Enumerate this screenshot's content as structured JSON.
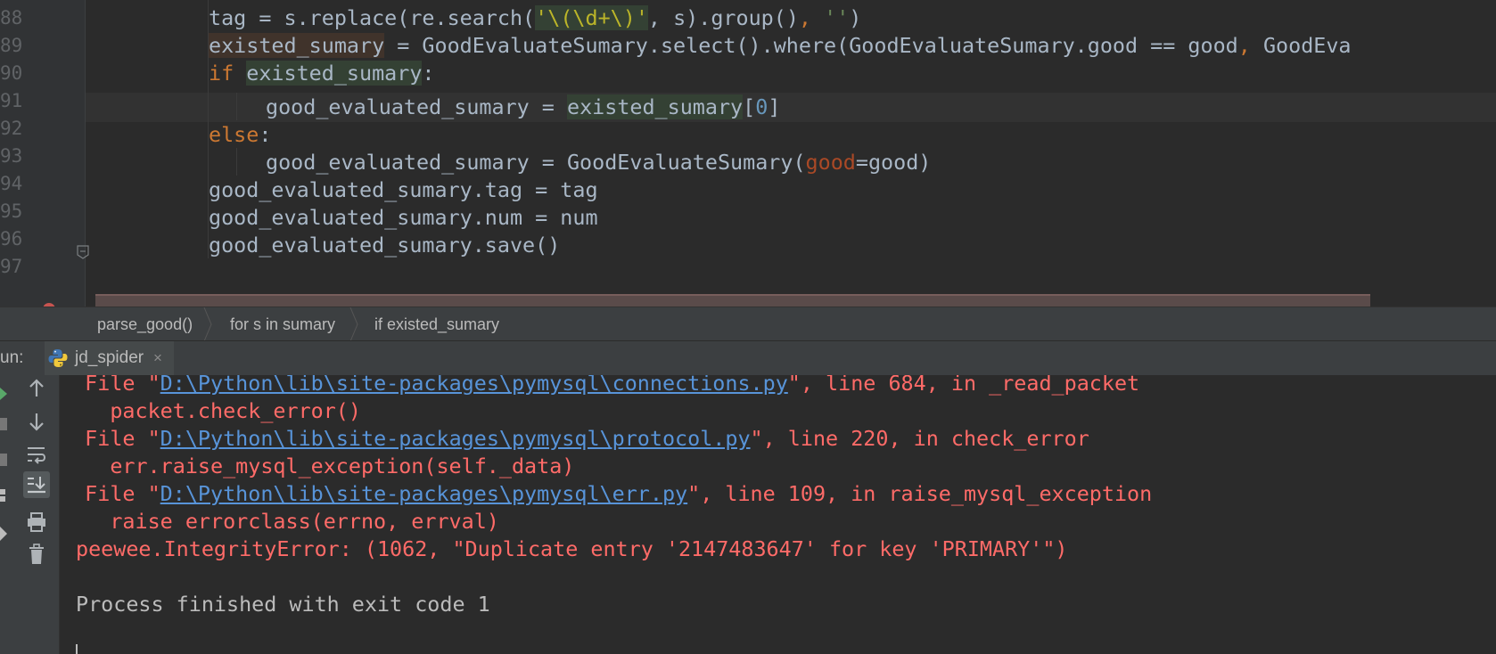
{
  "editor": {
    "lines": [
      {
        "num": "88"
      },
      {
        "num": "89"
      },
      {
        "num": "90"
      },
      {
        "num": "91"
      },
      {
        "num": "92"
      },
      {
        "num": "93"
      },
      {
        "num": "94"
      },
      {
        "num": "95"
      },
      {
        "num": "96"
      },
      {
        "num": "97"
      }
    ],
    "code": {
      "l88": {
        "a": "tag = s.replace(re.search(",
        "b": "'",
        "c": "\\(\\d+\\)",
        "d": "'",
        "e": ", s).group()",
        "f": ",",
        "g": " ",
        "h": "''",
        "i": ")"
      },
      "l89": {
        "a": "existed_sumary",
        "b": " = GoodEvaluateSumary.select().where(GoodEvaluateSumary.good == good",
        "c": ",",
        "d": " GoodEva"
      },
      "l90": {
        "a": "if",
        "b": " ",
        "c": "existed_sumary",
        "d": ":"
      },
      "l91": {
        "a": "good_evaluated_sumary = ",
        "b": "existed_sumary",
        "c": "[",
        "d": "0",
        "e": "]"
      },
      "l92": {
        "a": "else",
        "b": ":"
      },
      "l93": {
        "a": "good_evaluated_sumary = GoodEvaluateSumary(",
        "b": "good",
        "c": "=good)"
      },
      "l94": {
        "a": "good_evaluated_sumary.tag = tag"
      },
      "l95": {
        "a": "good_evaluated_sumary.num = num"
      },
      "l96": {
        "a": "good_evaluated_sumary.save()"
      }
    }
  },
  "breadcrumb": {
    "items": [
      "parse_good()",
      "for s in sumary",
      "if existed_sumary"
    ]
  },
  "run": {
    "label": "un:",
    "tab_name": "jd_spider",
    "tab_close": "×"
  },
  "toolbar": {
    "icons": [
      "up-arrow-icon",
      "down-arrow-icon",
      "soft-wrap-icon",
      "scroll-to-end-icon",
      "print-icon",
      "trash-icon"
    ]
  },
  "console": {
    "l1": {
      "a": "  File \"",
      "link": "D:\\Python\\lib\\site-packages\\pymysql\\connections.py",
      "b": "\", line 684, in _read_packet"
    },
    "l2": {
      "a": "    packet.check_error()"
    },
    "l3": {
      "a": "  File \"",
      "link": "D:\\Python\\lib\\site-packages\\pymysql\\protocol.py",
      "b": "\", line 220, in check_error"
    },
    "l4": {
      "a": "    err.raise_mysql_exception(self._data)"
    },
    "l5": {
      "a": "  File \"",
      "link": "D:\\Python\\lib\\site-packages\\pymysql\\err.py",
      "b": "\", line 109, in raise_mysql_exception"
    },
    "l6": {
      "a": "    raise errorclass(errno, errval)"
    },
    "l7": {
      "a": "peewee.IntegrityError: (1062, \"Duplicate entry '2147483647' for key 'PRIMARY'\")"
    },
    "l8": {
      "a": ""
    },
    "l9": {
      "a": "Process finished with exit code 1"
    }
  },
  "colors": {
    "editor_bg": "#2b2b2b",
    "keyword": "#cc7832",
    "string": "#6a8759",
    "number": "#6897bb",
    "param": "#aa4926",
    "error_text": "#ff6b68",
    "link": "#5894d9",
    "panel_bg": "#3c3f41"
  }
}
